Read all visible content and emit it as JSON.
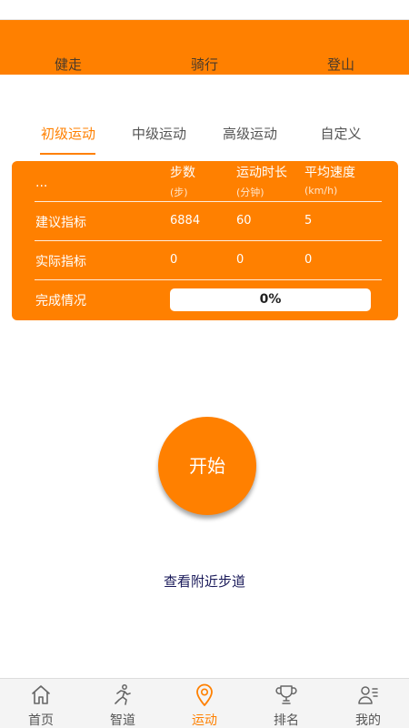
{
  "activity_tabs": [
    "健走",
    "骑行",
    "登山"
  ],
  "level_tabs": [
    "初级运动",
    "中级运动",
    "高级运动",
    "自定义"
  ],
  "active_level": 0,
  "table": {
    "corner": "...",
    "columns": [
      {
        "title": "步数",
        "unit": "(步)"
      },
      {
        "title": "运动时长",
        "unit": "(分钟)"
      },
      {
        "title": "平均速度",
        "unit": "(km/h)"
      }
    ],
    "rows": [
      {
        "label": "建议指标",
        "values": [
          "6884",
          "60",
          "5"
        ]
      },
      {
        "label": "实际指标",
        "values": [
          "0",
          "0",
          "0"
        ]
      }
    ],
    "completion_label": "完成情况",
    "completion_text": "0%",
    "completion_percent": 0
  },
  "start_button": "开始",
  "nearby_link": "查看附近步道",
  "bottom_nav": [
    {
      "label": "首页",
      "icon": "home-icon"
    },
    {
      "label": "智道",
      "icon": "runner-icon"
    },
    {
      "label": "运动",
      "icon": "location-pin-icon"
    },
    {
      "label": "排名",
      "icon": "trophy-icon"
    },
    {
      "label": "我的",
      "icon": "profile-icon"
    }
  ],
  "active_nav": 2,
  "colors": {
    "accent": "#ff8000",
    "nav_inactive": "#555555"
  }
}
